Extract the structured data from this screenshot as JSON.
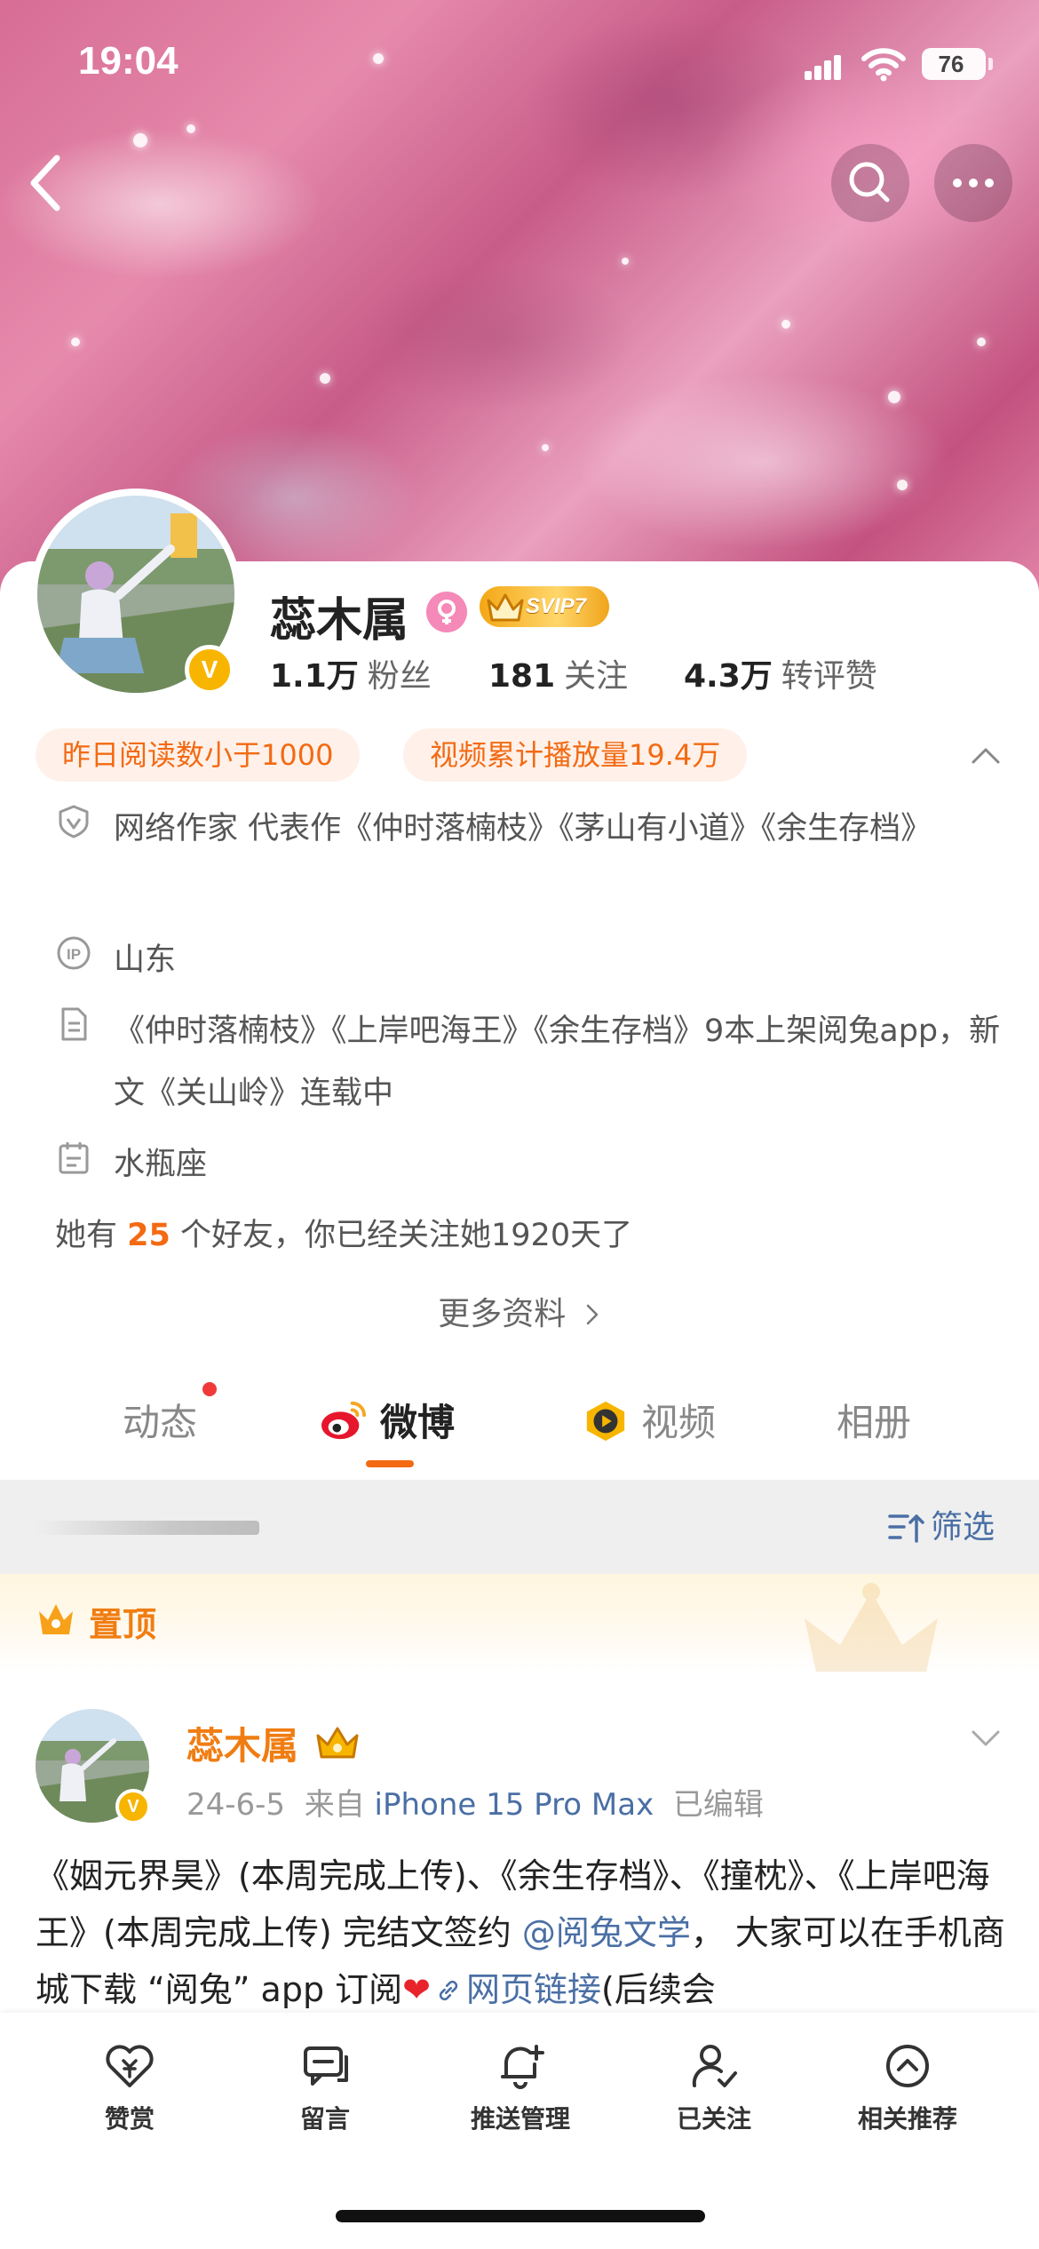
{
  "status_bar": {
    "time": "19:04",
    "battery": "76"
  },
  "profile": {
    "name": "蕊木属",
    "svip": "SVIP7",
    "verified_mark": "V",
    "stats": [
      {
        "value": "1.1万",
        "label": "粉丝"
      },
      {
        "value": "181",
        "label": "关注"
      },
      {
        "value": "4.3万",
        "label": "转评赞"
      }
    ],
    "tags": [
      "昨日阅读数小于1000",
      "视频累计播放量19.4万"
    ],
    "info": [
      {
        "icon": "shield-icon",
        "text": "网络作家 代表作《仲时落楠枝》《茅山有小道》《余生存档》"
      },
      {
        "icon": "ip-icon",
        "text": "山东"
      },
      {
        "icon": "document-icon",
        "text": "《仲时落楠枝》《上岸吧海王》《余生存档》9本上架阅兔app，新文《关山岭》连载中"
      },
      {
        "icon": "calendar-icon",
        "text": "水瓶座"
      }
    ],
    "friends": {
      "prefix": "她有",
      "count": "25",
      "suffix": "个好友，你已经关注她1920天了"
    },
    "more_info": "更多资料"
  },
  "tabs": [
    {
      "label": "动态"
    },
    {
      "label": "微博"
    },
    {
      "label": "视频"
    },
    {
      "label": "相册"
    }
  ],
  "filter": {
    "label": "筛选"
  },
  "pinned": {
    "label": "置顶"
  },
  "post": {
    "author": "蕊木属",
    "date": "24-6-5",
    "from_label": "来自",
    "source": "iPhone 15 Pro Max",
    "edited": "已编辑",
    "text_part1": "《姻元界昊》(本周完成上传)、《余生存档》、《撞枕》、《上岸吧海王》(本周完成上传) 完结文签约",
    "mention": "@阅兔文学",
    "text_part2": "， 大家可以在手机商城下载 “阅兔” app 订阅",
    "link": "网页链接",
    "text_part3": "(后续会"
  },
  "bottom_actions": [
    {
      "label": "赞赏",
      "icon": "reward-heart-icon"
    },
    {
      "label": "留言",
      "icon": "message-icon"
    },
    {
      "label": "推送管理",
      "icon": "bell-plus-icon"
    },
    {
      "label": "已关注",
      "icon": "user-check-icon"
    },
    {
      "label": "相关推荐",
      "icon": "chevron-up-circle-icon"
    }
  ],
  "colors": {
    "accent": "#f36a13",
    "link": "#4a6fa5",
    "gold": "#f7b500"
  }
}
